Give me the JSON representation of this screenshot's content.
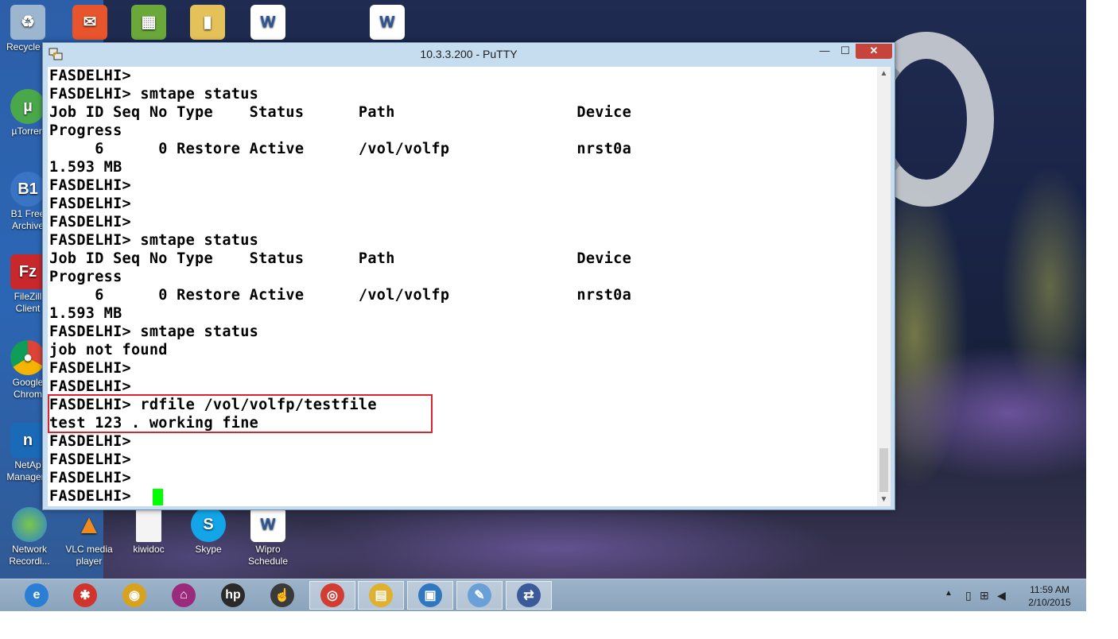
{
  "window": {
    "title": "10.3.3.200 - PuTTY",
    "minimize_glyph": "—",
    "maximize_glyph": "☐",
    "close_glyph": "✕"
  },
  "terminal": {
    "lines": [
      "FASDELHI>",
      "FASDELHI> smtape status",
      "Job ID Seq No Type    Status      Path                    Device",
      "Progress",
      "     6      0 Restore Active      /vol/volfp              nrst0a",
      "1.593 MB",
      "FASDELHI>",
      "FASDELHI>",
      "FASDELHI>",
      "FASDELHI> smtape status",
      "Job ID Seq No Type    Status      Path                    Device",
      "Progress",
      "     6      0 Restore Active      /vol/volfp              nrst0a",
      "1.593 MB",
      "FASDELHI> smtape status",
      "job not found",
      "FASDELHI>",
      "FASDELHI>",
      "FASDELHI> rdfile /vol/volfp/testfile",
      "test 123 . working fine",
      "FASDELHI>",
      "FASDELHI>",
      "FASDELHI>",
      "FASDELHI>"
    ],
    "cursor_color": "#00ff00",
    "highlight_color": "#d9262c"
  },
  "desktop_icons": [
    {
      "label": "Recycle B",
      "icon": "recycle-bin-icon"
    },
    {
      "label": "µTorren",
      "icon": "utorrent-icon"
    },
    {
      "label": "B1 Free\nArchive",
      "icon": "b1-archiver-icon"
    },
    {
      "label": "FileZill\nClient",
      "icon": "filezilla-icon"
    },
    {
      "label": "Google\nChrom",
      "icon": "chrome-icon"
    },
    {
      "label": "NetAp\nManagem",
      "icon": "netapp-icon"
    },
    {
      "label": "Network\nRecordi...",
      "icon": "network-recorder-icon"
    },
    {
      "label": "VLC media\nplayer",
      "icon": "vlc-icon"
    },
    {
      "label": "kiwidoc",
      "icon": "document-icon"
    },
    {
      "label": "Skype",
      "icon": "skype-icon"
    },
    {
      "label": "Wipro\nSchedule",
      "icon": "word-document-icon"
    }
  ],
  "taskbar": {
    "items": [
      {
        "name": "internet-explorer-icon",
        "glyph": "e",
        "color": "#2a7fd4"
      },
      {
        "name": "media-app-icon",
        "glyph": "✱",
        "color": "#d0342c"
      },
      {
        "name": "media-player-icon",
        "glyph": "◉",
        "color": "#d8a21e"
      },
      {
        "name": "remote-app-icon",
        "glyph": "⌂",
        "color": "#9c2a7c"
      },
      {
        "name": "hp-icon",
        "glyph": "hp",
        "color": "#2a2a2a"
      },
      {
        "name": "cursor-app-icon",
        "glyph": "☝",
        "color": "#3a3a3a"
      },
      {
        "name": "chrome-icon",
        "glyph": "◎",
        "color": "#d23d33"
      },
      {
        "name": "file-explorer-icon",
        "glyph": "▤",
        "color": "#e0b030"
      },
      {
        "name": "vmware-icon",
        "glyph": "▣",
        "color": "#2f78c0"
      },
      {
        "name": "paint-icon",
        "glyph": "✎",
        "color": "#6aa0d8"
      },
      {
        "name": "putty-icon",
        "glyph": "⇄",
        "color": "#3a5a9a"
      }
    ],
    "clock_time": "11:59 AM",
    "clock_date": "2/10/2015",
    "tray_chevron": "▲"
  }
}
